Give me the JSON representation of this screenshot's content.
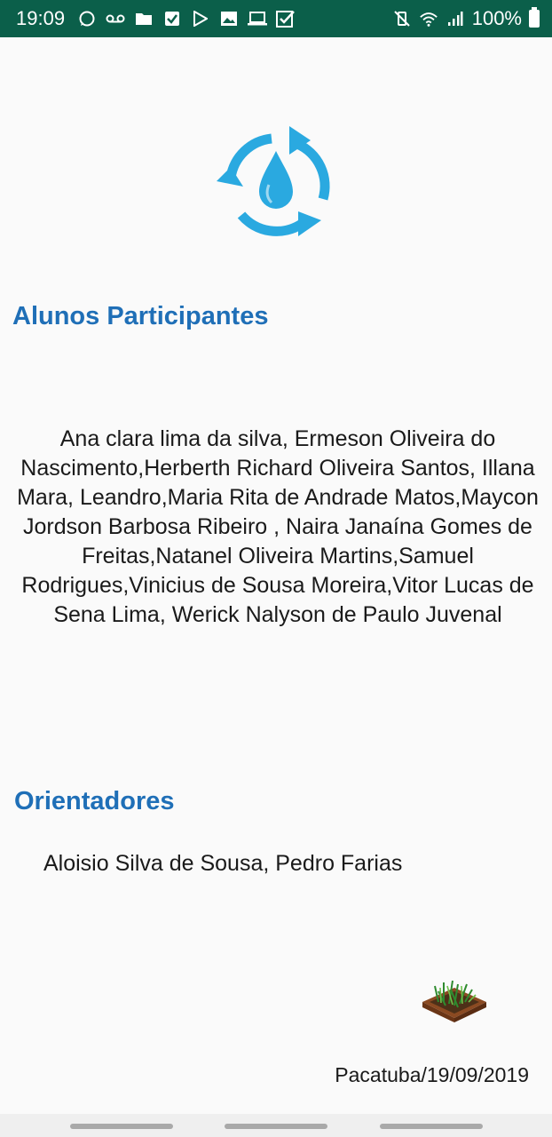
{
  "status_bar": {
    "time": "19:09",
    "battery_percent": "100%",
    "left_icons": [
      "whatsapp-icon",
      "voicemail-icon",
      "folder-icon",
      "checkbox-icon",
      "play-store-icon",
      "image-icon",
      "laptop-icon",
      "task-check-icon"
    ],
    "right_icons": [
      "mute-vibrate-icon",
      "wifi-icon",
      "signal-icon",
      "battery-icon"
    ]
  },
  "header": {
    "logo_icon": "water-cycle-icon",
    "logo_color": "#2aa9e0"
  },
  "alunos": {
    "title": "Alunos Participantes",
    "text": "Ana clara lima da silva, Ermeson Oliveira do Nascimento,Herberth Richard Oliveira Santos, Illana Mara, Leandro,Maria Rita de Andrade Matos,Maycon Jordson Barbosa Ribeiro , Naira Janaína Gomes de Freitas,Natanel Oliveira Martins,Samuel Rodrigues,Vinicius de Sousa Moreira,Vitor Lucas de Sena Lima, Werick Nalyson de Paulo Juvenal"
  },
  "orientadores": {
    "title": "Orientadores",
    "text": "Aloisio Silva de Sousa, Pedro Farias"
  },
  "footer": {
    "garden_icon": "garden-bed-icon",
    "date": "Pacatuba/19/09/2019"
  },
  "colors": {
    "title": "#1f6fb7",
    "status_bar": "#0b5f4a",
    "background": "#fafafa"
  }
}
